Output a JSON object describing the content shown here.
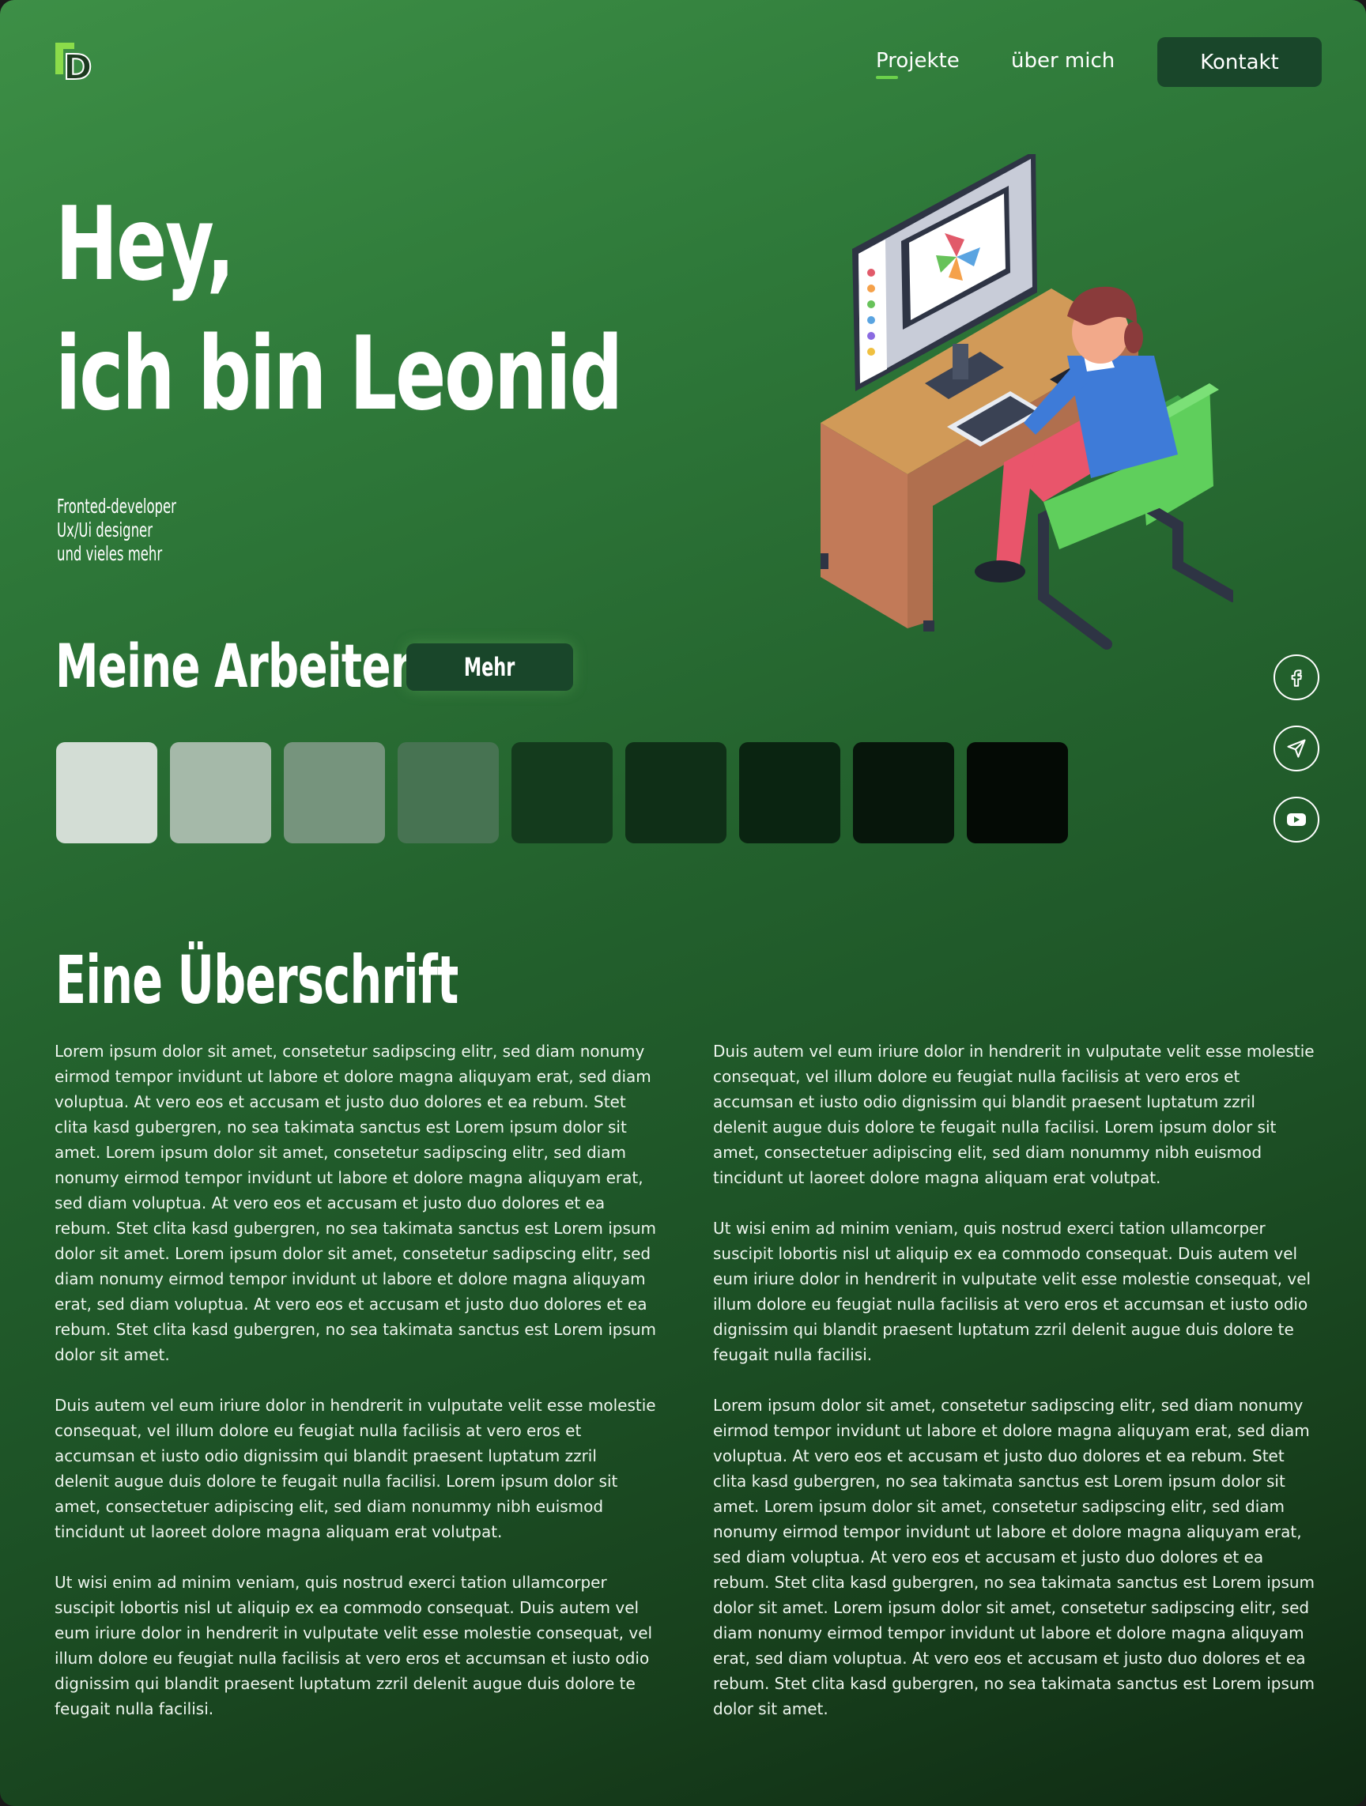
{
  "nav": {
    "logo_letter": "D",
    "links": [
      {
        "label": "Projekte",
        "active": true
      },
      {
        "label": "über mich",
        "active": false
      }
    ],
    "contact_label": "Kontakt"
  },
  "hero": {
    "title_line1": "Hey,",
    "title_line2": "ich bin Leonid",
    "roles": [
      "Fronted-developer",
      "Ux/Ui designer",
      "und vieles mehr"
    ]
  },
  "works": {
    "title": "Meine Arbeiten",
    "more_label": "Mehr",
    "swatch_colors": [
      "#d3ddd5",
      "#a5b9a9",
      "#76947d",
      "#477352",
      "#143b1d",
      "#0f2f17",
      "#0a2411",
      "#07160b",
      "#040a05"
    ]
  },
  "social": {
    "icons": [
      "facebook-icon",
      "send-icon",
      "youtube-icon"
    ]
  },
  "article": {
    "title": "Eine Überschrift",
    "left_paragraphs": [
      [
        "Lorem ipsum dolor sit amet, consetetur sadipscing elitr, sed diam nonumy",
        "eirmod tempor invidunt ut labore et dolore magna aliquyam erat, sed diam",
        "voluptua. At vero eos et accusam et justo duo dolores et ea rebum. Stet",
        "clita kasd gubergren, no sea takimata sanctus est Lorem ipsum dolor sit",
        "amet. Lorem ipsum dolor sit amet, consetetur sadipscing elitr, sed diam",
        "nonumy eirmod tempor invidunt ut labore et dolore magna aliquyam erat,",
        "sed diam voluptua. At vero eos et accusam et justo duo dolores et ea",
        "rebum. Stet clita kasd gubergren, no sea takimata sanctus est Lorem ipsum",
        "dolor sit amet. Lorem ipsum dolor sit amet, consetetur sadipscing elitr, sed",
        "diam nonumy eirmod tempor invidunt ut labore et dolore magna aliquyam",
        "erat, sed diam voluptua. At vero eos et accusam et justo duo dolores et ea",
        "rebum. Stet clita kasd gubergren, no sea takimata sanctus est Lorem ipsum",
        "dolor sit amet."
      ],
      [
        "Duis autem vel eum iriure dolor in hendrerit in vulputate velit esse molestie",
        "consequat, vel illum dolore eu feugiat nulla facilisis at vero eros et",
        "accumsan et iusto odio dignissim qui blandit praesent luptatum zzril",
        "delenit augue duis dolore te feugait nulla facilisi. Lorem ipsum dolor sit",
        "amet, consectetuer adipiscing elit, sed diam nonummy nibh euismod",
        "tincidunt ut laoreet dolore magna aliquam erat volutpat."
      ],
      [
        "Ut wisi enim ad minim veniam, quis nostrud exerci tation ullamcorper",
        "suscipit lobortis nisl ut aliquip ex ea commodo consequat. Duis autem vel",
        "eum iriure dolor in hendrerit in vulputate velit esse molestie consequat, vel",
        "illum dolore eu feugiat nulla facilisis at vero eros et accumsan et iusto odio",
        "dignissim qui blandit praesent luptatum zzril delenit augue duis dolore te",
        "feugait nulla facilisi."
      ]
    ],
    "right_paragraphs": [
      [
        "Duis autem vel eum iriure dolor in hendrerit in vulputate velit esse molestie",
        "consequat, vel illum dolore eu feugiat nulla facilisis at vero eros et",
        "accumsan et iusto odio dignissim qui blandit praesent luptatum zzril",
        "delenit augue duis dolore te feugait nulla facilisi. Lorem ipsum dolor sit",
        "amet, consectetuer adipiscing elit, sed diam nonummy nibh euismod",
        "tincidunt ut laoreet dolore magna aliquam erat volutpat."
      ],
      [
        "Ut wisi enim ad minim veniam, quis nostrud exerci tation ullamcorper",
        "suscipit lobortis nisl ut aliquip ex ea commodo consequat. Duis autem vel",
        "eum iriure dolor in hendrerit in vulputate velit esse molestie consequat, vel",
        "illum dolore eu feugiat nulla facilisis at vero eros et accumsan et iusto odio",
        "dignissim qui blandit praesent luptatum zzril delenit augue duis dolore te",
        "feugait nulla facilisi."
      ],
      [
        "Lorem ipsum dolor sit amet, consetetur sadipscing elitr, sed diam nonumy",
        "eirmod tempor invidunt ut labore et dolore magna aliquyam erat, sed diam",
        "voluptua. At vero eos et accusam et justo duo dolores et ea rebum. Stet",
        "clita kasd gubergren, no sea takimata sanctus est Lorem ipsum dolor sit",
        "amet. Lorem ipsum dolor sit amet, consetetur sadipscing elitr, sed diam",
        "nonumy eirmod tempor invidunt ut labore et dolore magna aliquyam erat,",
        "sed diam voluptua. At vero eos et accusam et justo duo dolores et ea",
        "rebum. Stet clita kasd gubergren, no sea takimata sanctus est Lorem ipsum",
        "dolor sit amet. Lorem ipsum dolor sit amet, consetetur sadipscing elitr, sed",
        "diam nonumy eirmod tempor invidunt ut labore et dolore magna aliquyam",
        "erat, sed diam voluptua. At vero eos et accusam et justo duo dolores et ea",
        "rebum. Stet clita kasd gubergren, no sea takimata sanctus est Lorem ipsum",
        "dolor sit amet."
      ]
    ]
  }
}
